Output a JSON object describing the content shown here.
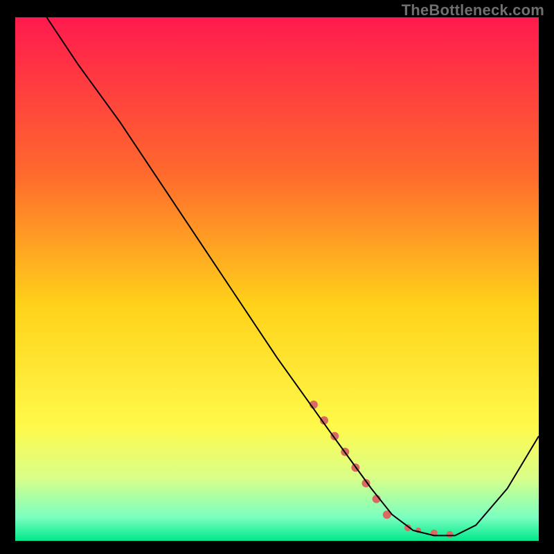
{
  "watermark": "TheBottleneck.com",
  "chart_data": {
    "type": "line",
    "title": "",
    "xlabel": "",
    "ylabel": "",
    "xlim": [
      0,
      100
    ],
    "ylim": [
      0,
      100
    ],
    "grid": false,
    "legend": false,
    "background_gradient_stops": [
      {
        "offset": 0.0,
        "color": "#ff1a4e"
      },
      {
        "offset": 0.3,
        "color": "#ff6a2d"
      },
      {
        "offset": 0.55,
        "color": "#ffd21a"
      },
      {
        "offset": 0.78,
        "color": "#fff94a"
      },
      {
        "offset": 0.88,
        "color": "#d9ff8a"
      },
      {
        "offset": 0.955,
        "color": "#7affc0"
      },
      {
        "offset": 1.0,
        "color": "#00e88a"
      }
    ],
    "series": [
      {
        "name": "curve",
        "color": "#000000",
        "x": [
          6,
          12,
          20,
          30,
          40,
          50,
          60,
          68,
          72,
          76,
          80,
          84,
          88,
          94,
          100
        ],
        "values": [
          100,
          91,
          80,
          65,
          50,
          35,
          21,
          10,
          5,
          2,
          1,
          1,
          3,
          10,
          20
        ]
      }
    ],
    "markers": {
      "name": "highlight-dots",
      "color": "#d86a62",
      "points": [
        {
          "x": 57,
          "y": 26,
          "r": 6
        },
        {
          "x": 59,
          "y": 23,
          "r": 6
        },
        {
          "x": 61,
          "y": 20,
          "r": 6
        },
        {
          "x": 63,
          "y": 17,
          "r": 6
        },
        {
          "x": 65,
          "y": 14,
          "r": 6
        },
        {
          "x": 67,
          "y": 11,
          "r": 6
        },
        {
          "x": 69,
          "y": 8,
          "r": 6
        },
        {
          "x": 71,
          "y": 5,
          "r": 6
        },
        {
          "x": 75,
          "y": 2.5,
          "r": 5
        },
        {
          "x": 77,
          "y": 2,
          "r": 4
        },
        {
          "x": 80,
          "y": 1.5,
          "r": 5
        },
        {
          "x": 83,
          "y": 1.2,
          "r": 5
        }
      ]
    }
  }
}
